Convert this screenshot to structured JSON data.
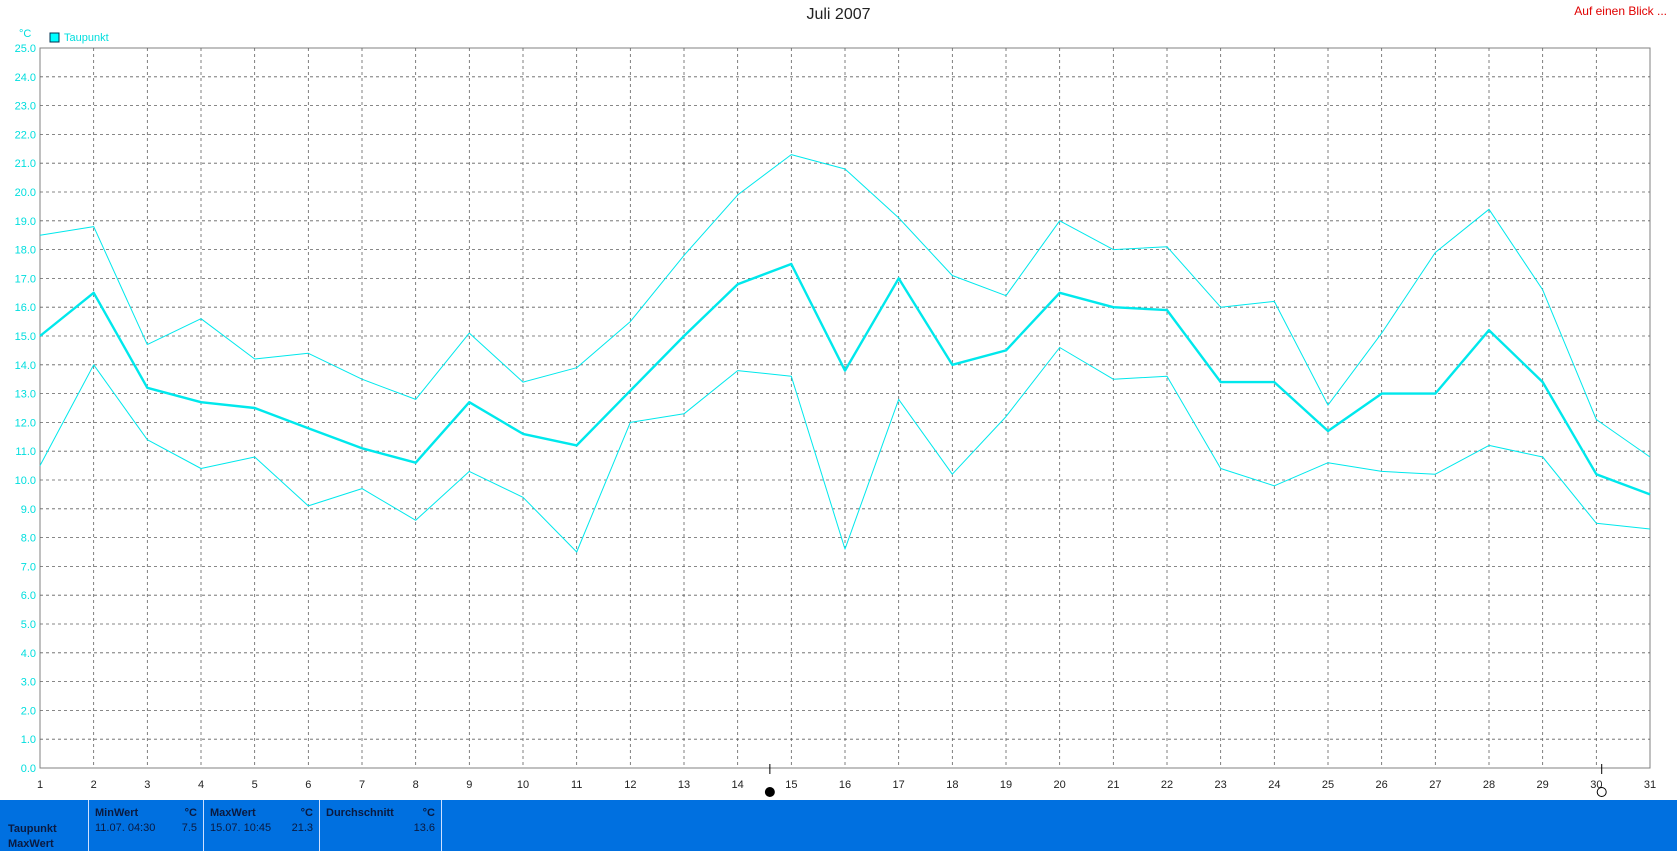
{
  "header": {
    "title": "Juli 2007",
    "link": "Auf einen Blick ..."
  },
  "chart_data": {
    "type": "line",
    "unit": "°C",
    "legend": "Taupunkt",
    "legend_position": "top-left",
    "grid": true,
    "x": [
      1,
      2,
      3,
      4,
      5,
      6,
      7,
      8,
      9,
      10,
      11,
      12,
      13,
      14,
      15,
      16,
      17,
      18,
      19,
      20,
      21,
      22,
      23,
      24,
      25,
      26,
      27,
      28,
      29,
      30,
      31
    ],
    "xlim": [
      1,
      31
    ],
    "ylim": [
      0,
      25
    ],
    "y_ticks": [
      "0.0",
      "1.0",
      "2.0",
      "3.0",
      "4.0",
      "5.0",
      "6.0",
      "7.0",
      "8.0",
      "9.0",
      "10.0",
      "11.0",
      "12.0",
      "13.0",
      "14.0",
      "15.0",
      "16.0",
      "17.0",
      "18.0",
      "19.0",
      "20.0",
      "21.0",
      "22.0",
      "23.0",
      "24.0",
      "25.0"
    ],
    "series": [
      {
        "name": "Taupunkt max",
        "values": [
          18.5,
          18.8,
          14.7,
          15.6,
          14.2,
          14.4,
          13.5,
          12.8,
          15.1,
          13.4,
          13.9,
          15.5,
          17.8,
          19.9,
          21.3,
          20.8,
          19.1,
          17.1,
          16.4,
          19.0,
          18.0,
          18.1,
          16.0,
          16.2,
          12.6,
          15.1,
          17.9,
          19.4,
          16.6,
          12.1,
          10.8
        ]
      },
      {
        "name": "Taupunkt",
        "values": [
          15.0,
          16.5,
          13.2,
          12.7,
          12.5,
          11.8,
          11.1,
          10.6,
          12.7,
          11.6,
          11.2,
          13.1,
          15.0,
          16.8,
          17.5,
          13.8,
          17.0,
          14.0,
          14.5,
          16.5,
          16.0,
          15.9,
          13.4,
          13.4,
          11.7,
          13.0,
          13.0,
          15.2,
          13.4,
          10.2,
          9.5
        ]
      },
      {
        "name": "Taupunkt min",
        "values": [
          10.5,
          14.0,
          11.4,
          10.4,
          10.8,
          9.1,
          9.7,
          8.6,
          10.3,
          9.4,
          7.5,
          12.0,
          12.3,
          13.8,
          13.6,
          7.6,
          12.8,
          10.2,
          12.2,
          14.6,
          13.5,
          13.6,
          10.4,
          9.8,
          10.6,
          10.3,
          10.2,
          11.2,
          10.8,
          8.5,
          8.3
        ]
      }
    ],
    "markers": [
      {
        "name": "full-moon",
        "x": 14.6
      },
      {
        "name": "new-moon",
        "x": 30.1
      }
    ]
  },
  "footer": {
    "row_labels": [
      "Taupunkt",
      "MaxWert"
    ],
    "min": {
      "header": "MinWert",
      "unit": "°C",
      "datetime": "11.07.  04:30",
      "value": "7.5"
    },
    "max": {
      "header": "MaxWert",
      "unit": "°C",
      "datetime": "15.07.  10:45",
      "value": "21.3"
    },
    "avg": {
      "header": "Durchschnitt",
      "unit": "°C",
      "value": "13.6"
    }
  }
}
